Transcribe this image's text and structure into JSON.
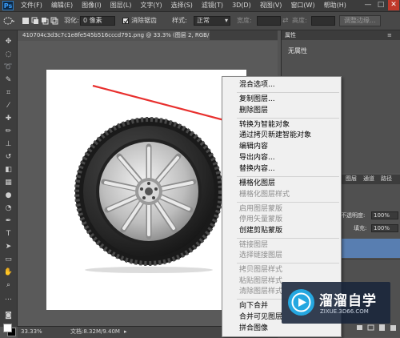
{
  "app": {
    "logo_text": "Ps"
  },
  "menu": [
    "文件(F)",
    "编辑(E)",
    "图像(I)",
    "图层(L)",
    "文字(Y)",
    "选择(S)",
    "滤镜(T)",
    "3D(D)",
    "视图(V)",
    "窗口(W)",
    "帮助(H)"
  ],
  "window_controls": {
    "minimize": "—",
    "maximize": "□",
    "close": "✕"
  },
  "options_bar": {
    "feather_label": "羽化:",
    "feather_value": "0 像素",
    "antialias_label": "消除锯齿",
    "style_label": "样式:",
    "style_value": "正常",
    "width_label": "宽度:",
    "height_label": "高度:",
    "refine_button": "调整边缘..."
  },
  "document": {
    "tab_label": "410704c3d3c7c1e8fe545b516cccd791.png @ 33.3% (图层 2, RGB/8) *",
    "tab_close": "×"
  },
  "status": {
    "zoom": "33.33%",
    "doc_size": "文档:8.32M/9.40M"
  },
  "properties_panel": {
    "tab": "属性",
    "title": "无属性"
  },
  "layers_panel": {
    "tabs": [
      "图层",
      "通道",
      "路径"
    ],
    "opacity_label": "不透明度:",
    "opacity_value": "100%",
    "fill_label": "填充:",
    "fill_value": "100%"
  },
  "context_menu": {
    "items": [
      {
        "label": "混合选项...",
        "disabled": false
      },
      {
        "label": "复制图层...",
        "disabled": false
      },
      {
        "label": "删除图层",
        "disabled": false
      },
      {
        "label": "转换为智能对象",
        "disabled": false
      },
      {
        "label": "通过拷贝新建智能对象",
        "disabled": false
      },
      {
        "label": "编辑内容",
        "disabled": false
      },
      {
        "label": "导出内容...",
        "disabled": false
      },
      {
        "label": "替换内容...",
        "disabled": false
      },
      {
        "label": "栅格化图层",
        "disabled": false
      },
      {
        "label": "栅格化图层样式",
        "disabled": true
      },
      {
        "label": "启用图层蒙版",
        "disabled": true
      },
      {
        "label": "停用矢量蒙版",
        "disabled": true
      },
      {
        "label": "创建剪贴蒙版",
        "disabled": false
      },
      {
        "label": "链接图层",
        "disabled": true
      },
      {
        "label": "选择链接图层",
        "disabled": true
      },
      {
        "label": "拷贝图层样式",
        "disabled": true
      },
      {
        "label": "粘贴图层样式",
        "disabled": true
      },
      {
        "label": "清除图层样式",
        "disabled": true
      },
      {
        "label": "向下合并",
        "disabled": false
      },
      {
        "label": "合并可见图层",
        "disabled": false
      },
      {
        "label": "拼合图像",
        "disabled": false
      }
    ]
  },
  "watermark": {
    "cn": "溜溜自学",
    "en": "ZIXUE.3D66.COM"
  },
  "colors": {
    "annotation_arrow": "#e8302e",
    "layer_selected": "#587eb1",
    "ps_blue": "#2f7cc0"
  }
}
